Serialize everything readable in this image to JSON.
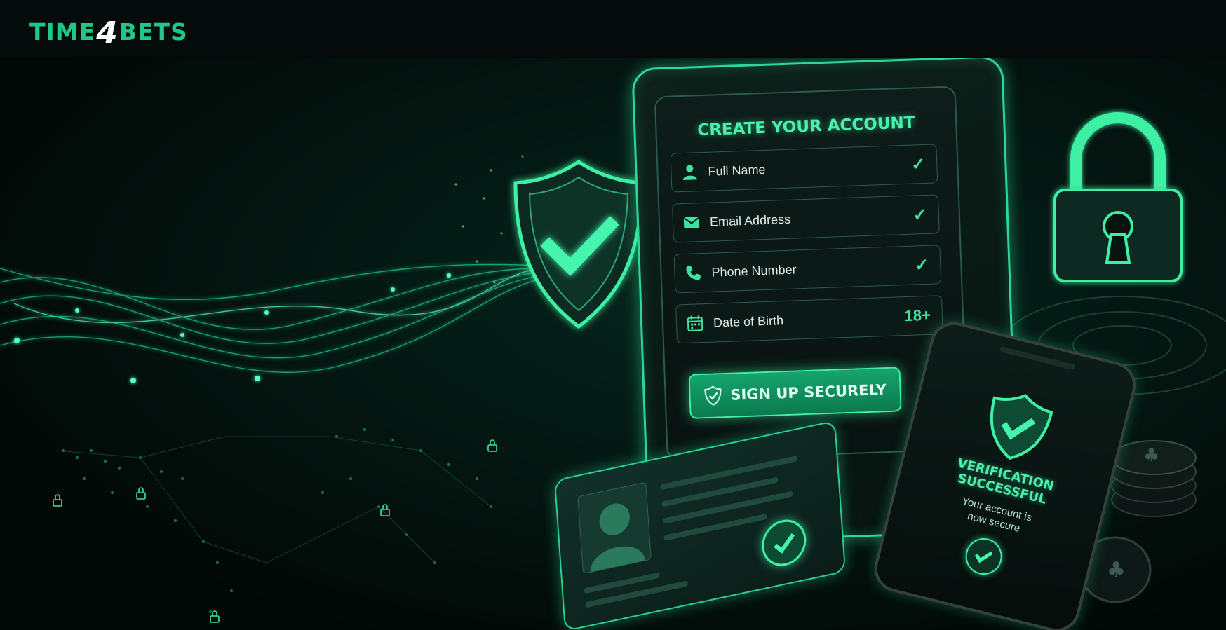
{
  "brand": {
    "logo_left": "TIME",
    "logo_number": "4",
    "logo_right": "BETS",
    "accent": "#1fc887"
  },
  "signup_form": {
    "title": "CREATE YOUR ACCOUNT",
    "fields": [
      {
        "label": "Full Name",
        "icon": "user-icon",
        "status": "✓"
      },
      {
        "label": "Email Address",
        "icon": "envelope-icon",
        "status": "✓"
      },
      {
        "label": "Phone Number",
        "icon": "phone-icon",
        "status": "✓"
      },
      {
        "label": "Date of Birth",
        "icon": "calendar-icon",
        "status": "18+"
      }
    ],
    "submit_label": "SIGN UP SECURELY"
  },
  "verification": {
    "title_line1": "VERIFICATION",
    "title_line2": "SUCCESSFUL",
    "subtitle_line1": "Your account is",
    "subtitle_line2": "now secure"
  },
  "colors": {
    "glow": "#3df0a3",
    "background": "#030807"
  }
}
